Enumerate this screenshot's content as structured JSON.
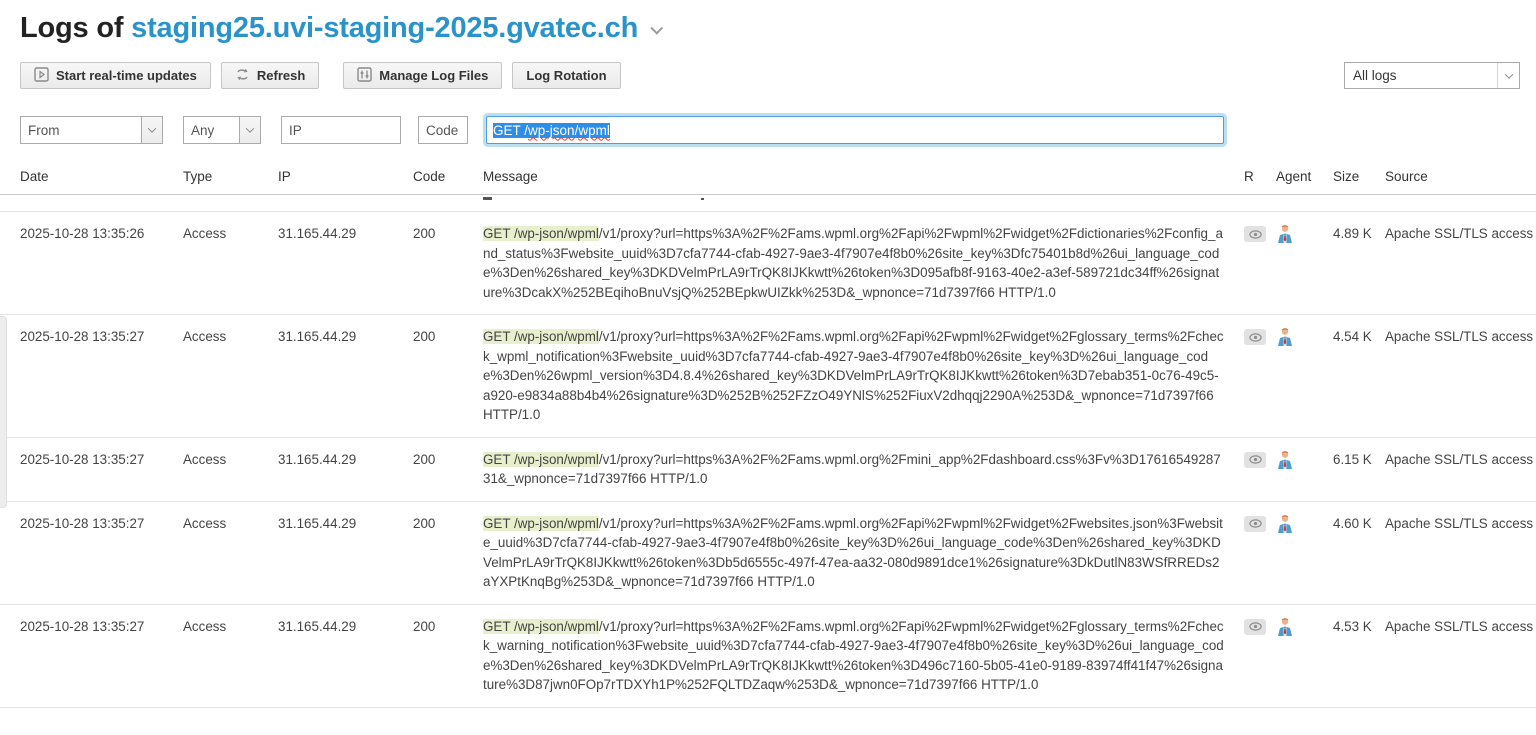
{
  "header": {
    "title_prefix": "Logs of ",
    "domain": "staging25.uvi-staging-2025.gvatec.ch"
  },
  "toolbar": {
    "start_realtime_label": "Start real-time updates",
    "refresh_label": "Refresh",
    "manage_log_files_label": "Manage Log Files",
    "log_rotation_label": "Log Rotation",
    "log_select_value": "All logs"
  },
  "filters": {
    "from_placeholder": "From",
    "type_placeholder": "Any",
    "ip_placeholder": "IP",
    "code_placeholder": "Code",
    "search_value": "GET /wp-json/wpml",
    "search_segments": [
      {
        "text": "GET ",
        "misspelled": false
      },
      {
        "text": "/",
        "misspelled": false
      },
      {
        "text": "wp-json",
        "misspelled": true
      },
      {
        "text": "/",
        "misspelled": false
      },
      {
        "text": "wpml",
        "misspelled": true
      }
    ]
  },
  "colors": {
    "link": "#2a93c9",
    "highlight": "#e8efcd",
    "selection": "#2e8de4",
    "squiggle": "#dd3c2e"
  },
  "table": {
    "headers": [
      "Date",
      "Type",
      "IP",
      "Code",
      "Message",
      "R",
      "Agent",
      "Size",
      "Source"
    ],
    "rows": [
      {
        "date": "2025-10-28 13:35:26",
        "type": "Access",
        "ip": "31.165.44.29",
        "code": "200",
        "message_prefix": "GET /wp-json/wpml",
        "message_rest": "/v1/proxy?url=https%3A%2F%2Fams.wpml.org%2Fapi%2Fwpml%2Fwidget%2Fdictionaries%2Fconfig_and_status%3Fwebsite_uuid%3D7cfa7744-cfab-4927-9ae3-4f7907e4f8b0%26site_key%3Dfc75401b8d%26ui_language_code%3Den%26shared_key%3DKDVelmPrLA9rTrQK8IJKkwtt%26token%3D095afb8f-9163-40e2-a3ef-589721dc34ff%26signature%3DcakX%252BEqihoBnuVsjQ%252BEpkwUIZkk%253D&_wpnonce=71d7397f66 HTTP/1.0",
        "size": "4.89 K",
        "source": "Apache SSL/TLS access"
      },
      {
        "date": "2025-10-28 13:35:27",
        "type": "Access",
        "ip": "31.165.44.29",
        "code": "200",
        "message_prefix": "GET /wp-json/wpml",
        "message_rest": "/v1/proxy?url=https%3A%2F%2Fams.wpml.org%2Fapi%2Fwpml%2Fwidget%2Fglossary_terms%2Fcheck_wpml_notification%3Fwebsite_uuid%3D7cfa7744-cfab-4927-9ae3-4f7907e4f8b0%26site_key%3D%26ui_language_code%3Den%26wpml_version%3D4.8.4%26shared_key%3DKDVelmPrLA9rTrQK8IJKkwtt%26token%3D7ebab351-0c76-49c5-a920-e9834a88b4b4%26signature%3D%252B%252FZzO49YNlS%252FiuxV2dhqqj2290A%253D&_wpnonce=71d7397f66 HTTP/1.0",
        "size": "4.54 K",
        "source": "Apache SSL/TLS access"
      },
      {
        "date": "2025-10-28 13:35:27",
        "type": "Access",
        "ip": "31.165.44.29",
        "code": "200",
        "message_prefix": "GET /wp-json/wpml",
        "message_rest": "/v1/proxy?url=https%3A%2F%2Fams.wpml.org%2Fmini_app%2Fdashboard.css%3Fv%3D1761654928731&_wpnonce=71d7397f66 HTTP/1.0",
        "size": "6.15 K",
        "source": "Apache SSL/TLS access"
      },
      {
        "date": "2025-10-28 13:35:27",
        "type": "Access",
        "ip": "31.165.44.29",
        "code": "200",
        "message_prefix": "GET /wp-json/wpml",
        "message_rest": "/v1/proxy?url=https%3A%2F%2Fams.wpml.org%2Fapi%2Fwpml%2Fwidget%2Fwebsites.json%3Fwebsite_uuid%3D7cfa7744-cfab-4927-9ae3-4f7907e4f8b0%26site_key%3D%26ui_language_code%3Den%26shared_key%3DKDVelmPrLA9rTrQK8IJKkwtt%26token%3Db5d6555c-497f-47ea-aa32-080d9891dce1%26signature%3DkDutlN83WSfRREDs2aYXPtKnqBg%253D&_wpnonce=71d7397f66 HTTP/1.0",
        "size": "4.60 K",
        "source": "Apache SSL/TLS access"
      },
      {
        "date": "2025-10-28 13:35:27",
        "type": "Access",
        "ip": "31.165.44.29",
        "code": "200",
        "message_prefix": "GET /wp-json/wpml",
        "message_rest": "/v1/proxy?url=https%3A%2F%2Fams.wpml.org%2Fapi%2Fwpml%2Fwidget%2Fglossary_terms%2Fcheck_warning_notification%3Fwebsite_uuid%3D7cfa7744-cfab-4927-9ae3-4f7907e4f8b0%26site_key%3D%26ui_language_code%3Den%26shared_key%3DKDVelmPrLA9rTrQK8IJKkwtt%26token%3D496c7160-5b05-41e0-9189-83974ff41f47%26signature%3D87jwn0FOp7rTDXYh1P%252FQLTDZaqw%253D&_wpnonce=71d7397f66 HTTP/1.0",
        "size": "4.53 K",
        "source": "Apache SSL/TLS access"
      }
    ]
  }
}
